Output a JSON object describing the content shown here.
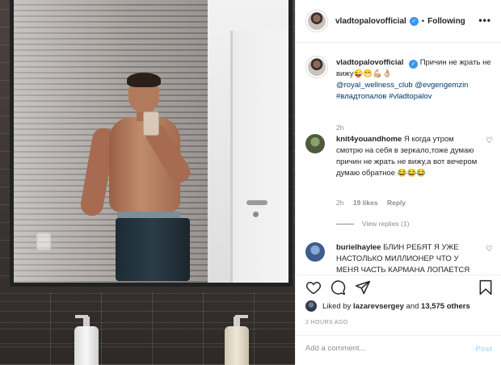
{
  "post": {
    "username": "vladtopalovofficial",
    "follow_dot": "•",
    "follow_state": "Following",
    "more_label": "•••"
  },
  "caption": {
    "username": "vladtopalovofficial",
    "text": "Причин не жрать не вижу😜😁💪🏼👌🏼",
    "mentions": [
      "@royal_wellness_club",
      "@evgengemzin"
    ],
    "hashtags": [
      "#владтопалов",
      "#vladtopalov"
    ],
    "time": "2h"
  },
  "comments": [
    {
      "username": "knit4youandhome",
      "text": "Я когда утром смотрю на себя в зеркало,тоже думаю причин не жрать не вижу,а вот вечером думаю обратное 😂😂😂",
      "time": "2h",
      "likes": "19 likes",
      "reply": "Reply",
      "view_replies": "View replies (1)"
    },
    {
      "username": "burielhaylee",
      "text": "БЛИН РЕБЯТ Я УЖЕ НАСТОЛЬКО МИЛЛИОНЕР ЧТО У МЕНЯ ЧАСТЬ КАРМАНА ЛОПАЕТСЯ"
    }
  ],
  "likes": {
    "prefix": "Liked by",
    "user": "lazarevsergey",
    "joiner": "and",
    "others": "13,575 others"
  },
  "timestamp": "2 HOURS AGO",
  "add_comment": {
    "placeholder": "Add a comment...",
    "post_label": "Post"
  },
  "icons": {
    "verified": "verified-badge-icon",
    "like": "heart-icon",
    "comment": "comment-icon",
    "share": "paper-plane-icon",
    "save": "bookmark-icon",
    "more": "ellipsis-icon"
  },
  "colors": {
    "verified_blue": "#3897f0",
    "link": "#00376b",
    "muted": "#8e8e8e",
    "post_disabled": "#b2dffc"
  }
}
